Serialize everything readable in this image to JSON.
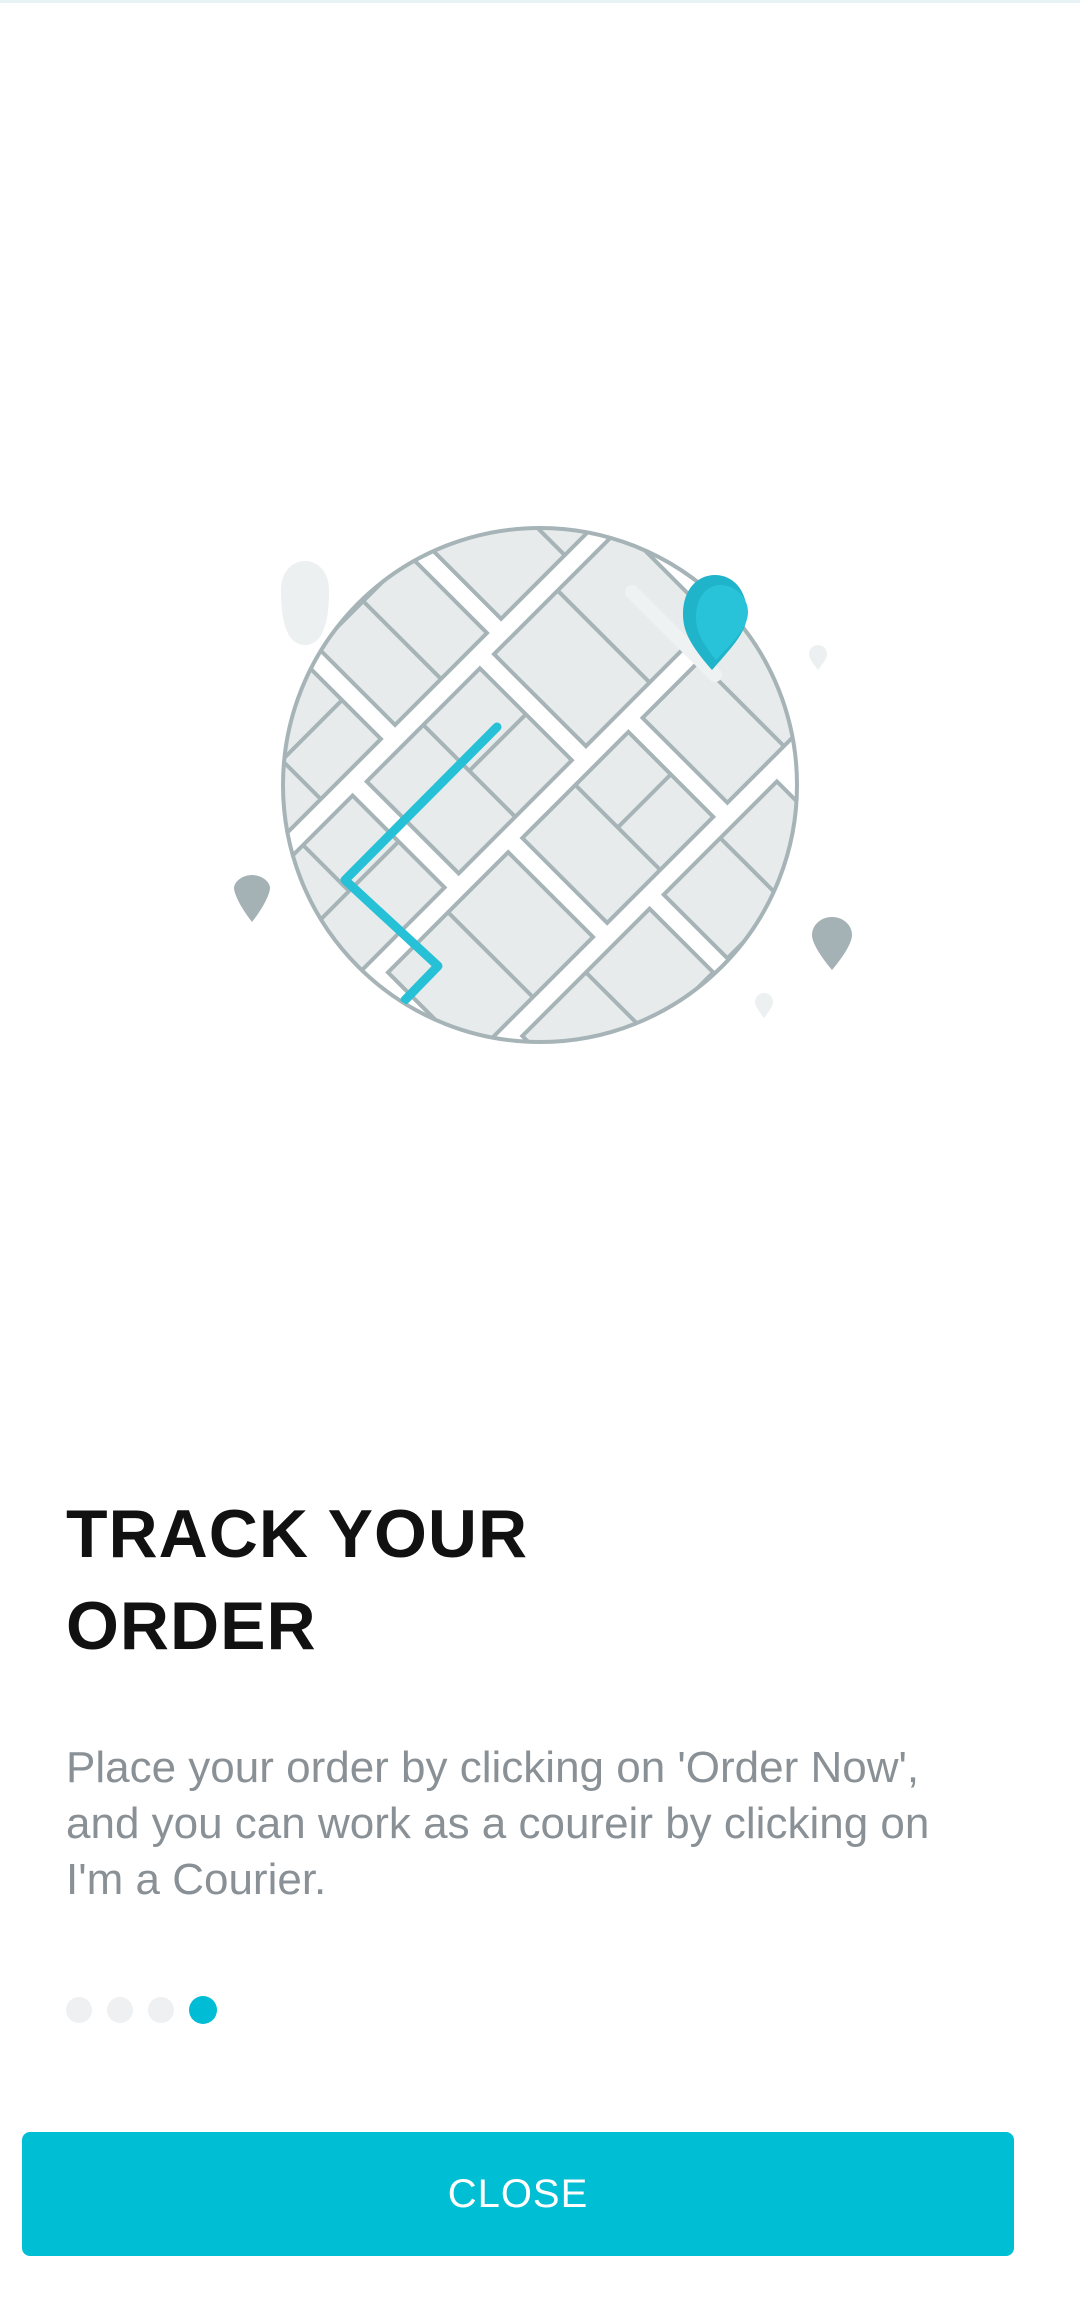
{
  "onboarding": {
    "title_lines": [
      "TRACK YOUR",
      "ORDER"
    ],
    "description_lines": [
      "Place your order by clicking on 'Order Now',",
      "and you can work as a coureir by clicking on",
      "I'm a Courier."
    ],
    "page_indicator": {
      "total_pages": 4,
      "current_page": 4
    },
    "close_button_label": "CLOSE",
    "illustration_icon": "map-tracking-icon"
  },
  "colors": {
    "accent": "#00bed4",
    "route": "#26c1d6",
    "map_outline": "#a6b4b8",
    "block_fill": "#e7ebeb",
    "title_text": "#111111",
    "body_text": "#8a9196",
    "dot_inactive": "#eef0f1"
  }
}
